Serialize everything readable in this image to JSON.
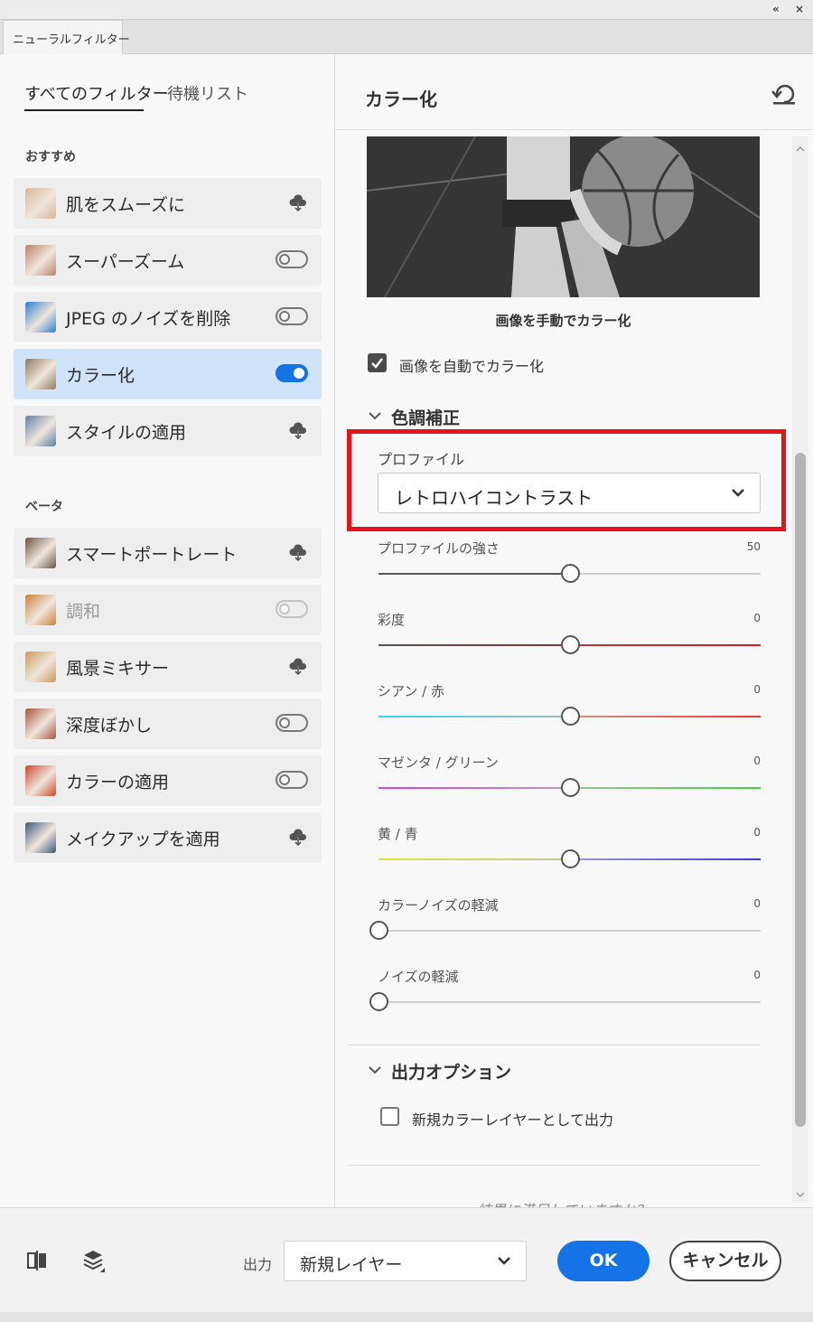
{
  "window": {
    "collapse_glyph": "«",
    "close_glyph": "×",
    "tab_label": "ニューラルフィルター"
  },
  "filter_tabs": {
    "all": "すべてのフィルター",
    "waitlist": "待機リスト"
  },
  "sections": {
    "featured": "おすすめ",
    "beta": "ベータ"
  },
  "filters": [
    {
      "name": "肌をスムーズに",
      "control": "cloud-download",
      "thumb_color": "#d9b59a"
    },
    {
      "name": "スーパーズーム",
      "control": "toggle-off",
      "thumb_color": "#b9826a"
    },
    {
      "name": "JPEG のノイズを削除",
      "control": "toggle-off",
      "thumb_color": "#2f7dd1"
    },
    {
      "name": "カラー化",
      "control": "toggle-on",
      "thumb_color": "#8f7a5e"
    },
    {
      "name": "スタイルの適用",
      "control": "cloud-download",
      "thumb_color": "#5f7fa8"
    },
    {
      "name": "スマートポートレート",
      "control": "cloud-download",
      "thumb_color": "#6b5445"
    },
    {
      "name": "調和",
      "control": "toggle-off-disabled",
      "thumb_color": "#c8823a"
    },
    {
      "name": "風景ミキサー",
      "control": "cloud-download",
      "thumb_color": "#c99a5a"
    },
    {
      "name": "深度ぼかし",
      "control": "toggle-off",
      "thumb_color": "#a7543f"
    },
    {
      "name": "カラーの適用",
      "control": "toggle-off",
      "thumb_color": "#d0442a"
    },
    {
      "name": "メイクアップを適用",
      "control": "cloud-download",
      "thumb_color": "#3f5a7a"
    }
  ],
  "panel": {
    "title": "カラー化",
    "preview_caption": "画像を手動でカラー化",
    "auto_colorize": {
      "label": "画像を自動でカラー化",
      "checked": true
    },
    "color_adjust_heading": "色調補正",
    "profile": {
      "label": "プロファイル",
      "value": "レトロハイコントラスト"
    },
    "sliders": [
      {
        "label": "プロファイルの強さ",
        "value": "50",
        "fraction": 0.5,
        "style": "neutral"
      },
      {
        "label": "彩度",
        "value": "0",
        "fraction": 0.5,
        "style": "saturation"
      },
      {
        "label": "シアン / 赤",
        "value": "0",
        "fraction": 0.5,
        "style": "cyan-red"
      },
      {
        "label": "マゼンタ / グリーン",
        "value": "0",
        "fraction": 0.5,
        "style": "magenta-green"
      },
      {
        "label": "黄 / 青",
        "value": "0",
        "fraction": 0.5,
        "style": "yellow-blue"
      },
      {
        "label": "カラーノイズの軽減",
        "value": "0",
        "fraction": 0.0,
        "style": "plain"
      },
      {
        "label": "ノイズの軽減",
        "value": "0",
        "fraction": 0.0,
        "style": "plain"
      }
    ],
    "output_options_heading": "出力オプション",
    "new_color_layer": {
      "label": "新規カラーレイヤーとして出力",
      "checked": false
    },
    "feedback_prompt": "結果に満足していますか？"
  },
  "footer": {
    "output_label": "出力",
    "output_value": "新規レイヤー",
    "ok_label": "OK",
    "cancel_label": "キャンセル"
  },
  "colors": {
    "accent": "#1473e6",
    "highlight_box": "#e5141b",
    "selected_item": "#d0e3f8"
  }
}
